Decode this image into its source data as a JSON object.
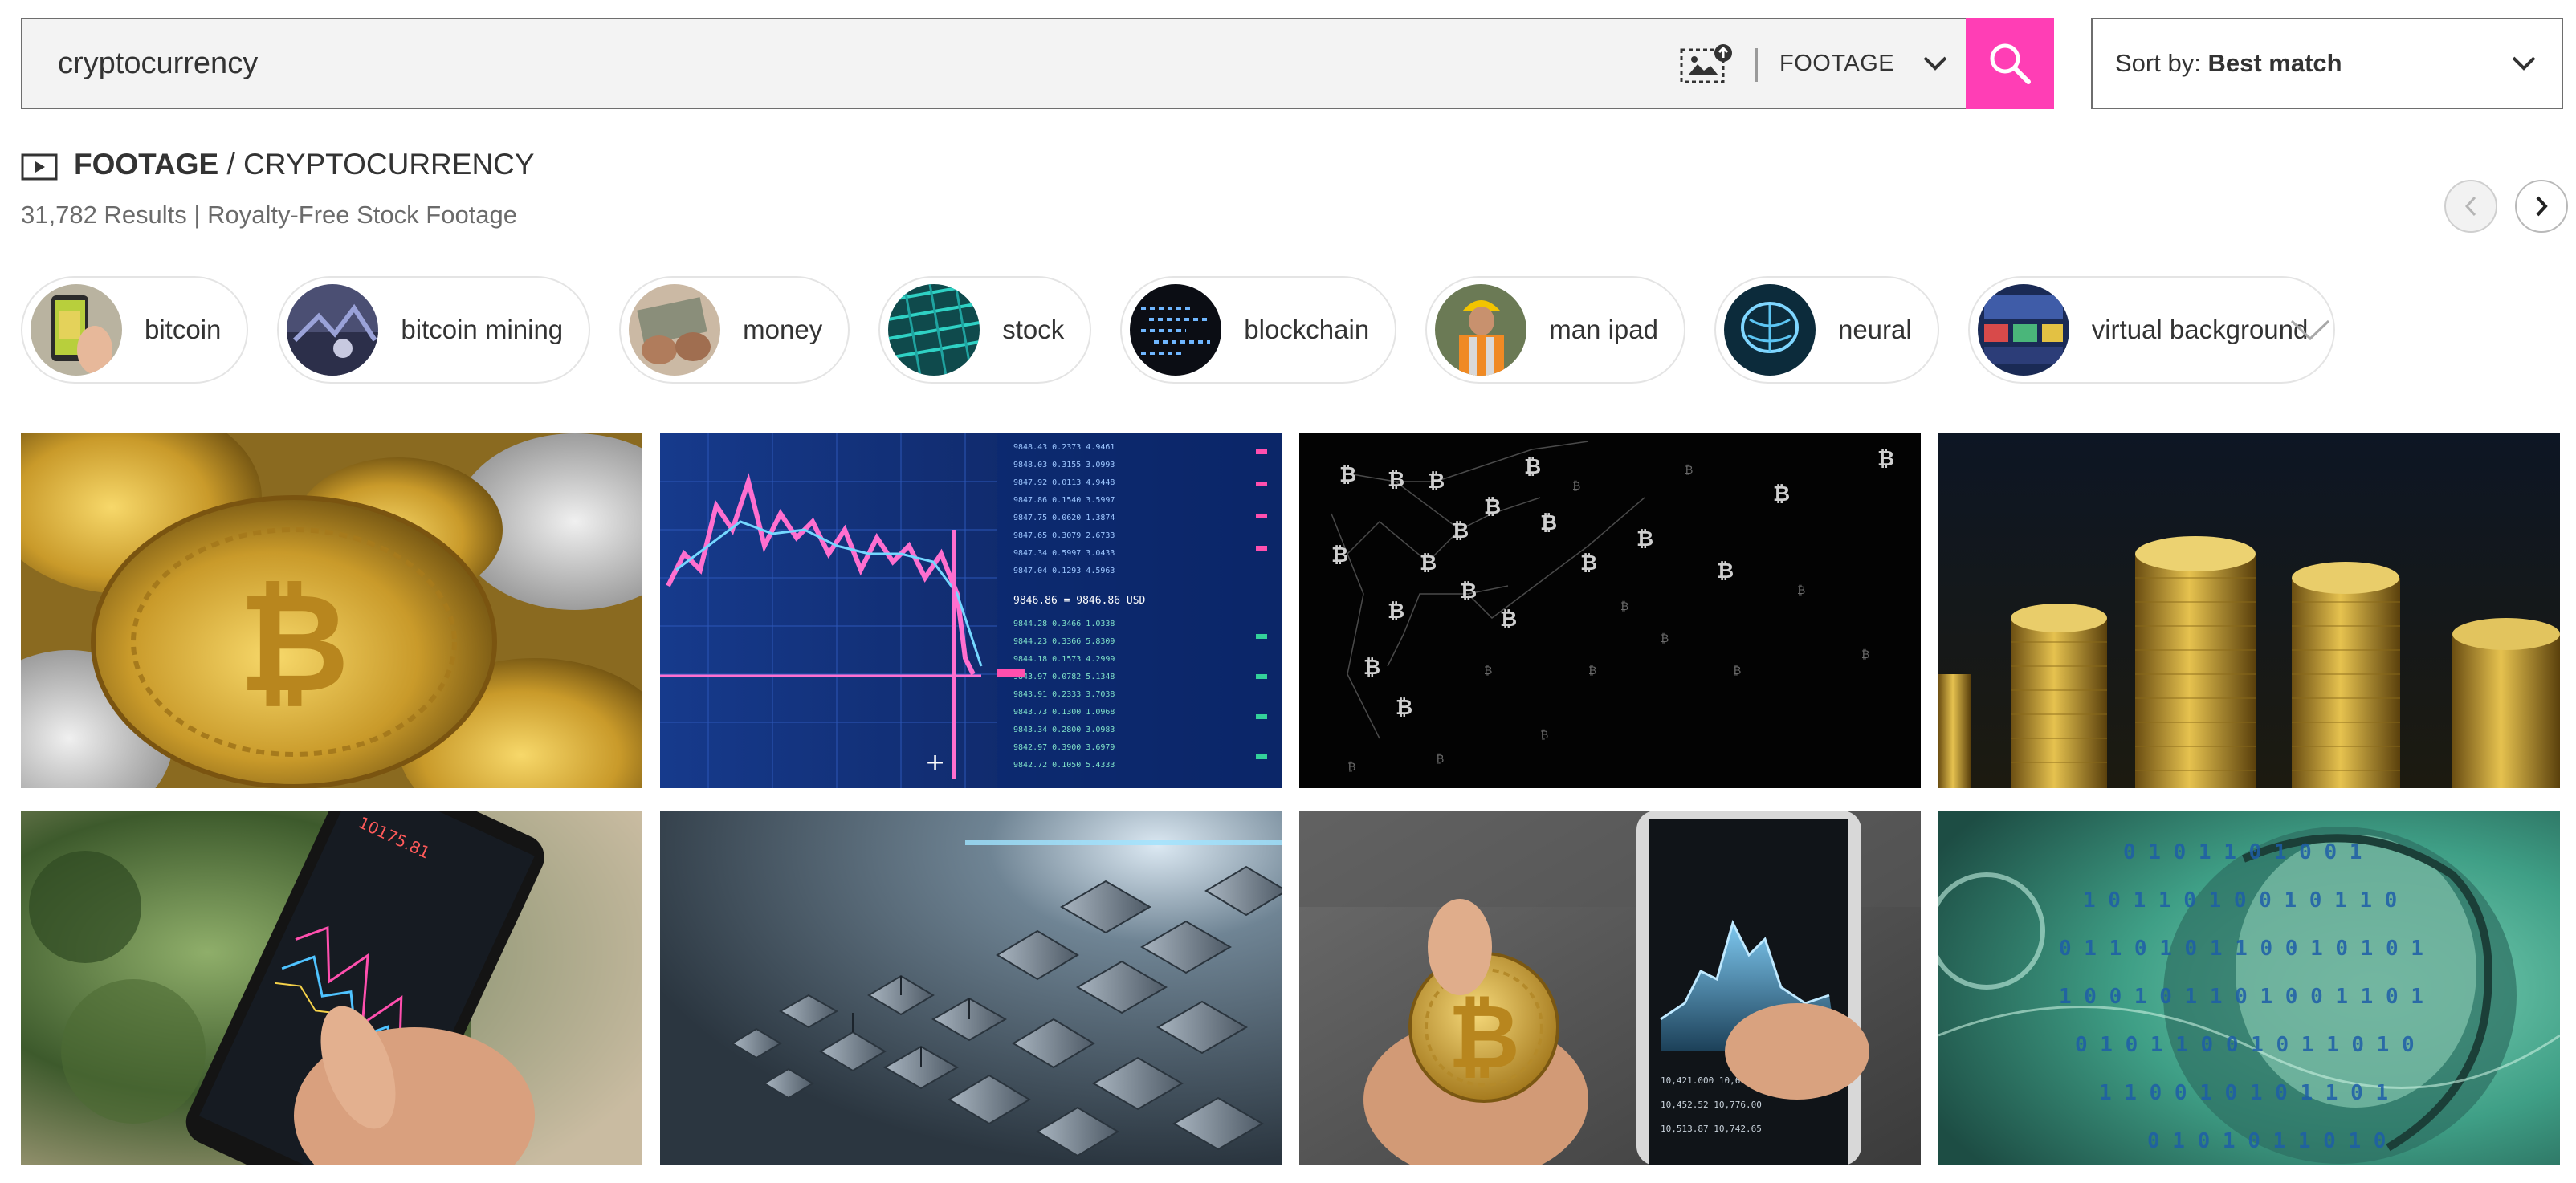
{
  "search": {
    "query": "cryptocurrency",
    "media_type": "FOOTAGE",
    "image_search_icon": "image-upload-icon",
    "submit_icon": "magnifier-icon"
  },
  "sort": {
    "prefix": "Sort by:",
    "value": "Best match"
  },
  "breadcrumb": {
    "root": "FOOTAGE",
    "separator": " / ",
    "current": "CRYPTOCURRENCY"
  },
  "results": {
    "summary": "31,782 Results | Royalty-Free Stock Footage"
  },
  "pagination": {
    "prev_icon": "chevron-left-icon",
    "next_icon": "chevron-right-icon"
  },
  "related": [
    {
      "label": "bitcoin"
    },
    {
      "label": "bitcoin mining"
    },
    {
      "label": "money"
    },
    {
      "label": "stock"
    },
    {
      "label": "blockchain"
    },
    {
      "label": "man ipad"
    },
    {
      "label": "neural"
    },
    {
      "label": "virtual background"
    }
  ],
  "grid_items": [
    {
      "subject": "gold and silver bitcoin coins"
    },
    {
      "subject": "candlestick price chart with order book",
      "chart_readout": "9846.86 = 9846.86 USD"
    },
    {
      "subject": "bitcoin network particles on black"
    },
    {
      "subject": "stacks of gold coins"
    },
    {
      "subject": "smartphone with crypto trading app",
      "price_readout": "10175.81"
    },
    {
      "subject": "abstract blockchain cubes"
    },
    {
      "subject": "hand holding bitcoin and phone chart"
    },
    {
      "subject": "dollar banknote with binary code"
    }
  ],
  "colors": {
    "accent": "#ff3eb5",
    "border": "#6e6e6e",
    "muted_text": "#6b6b6b"
  }
}
